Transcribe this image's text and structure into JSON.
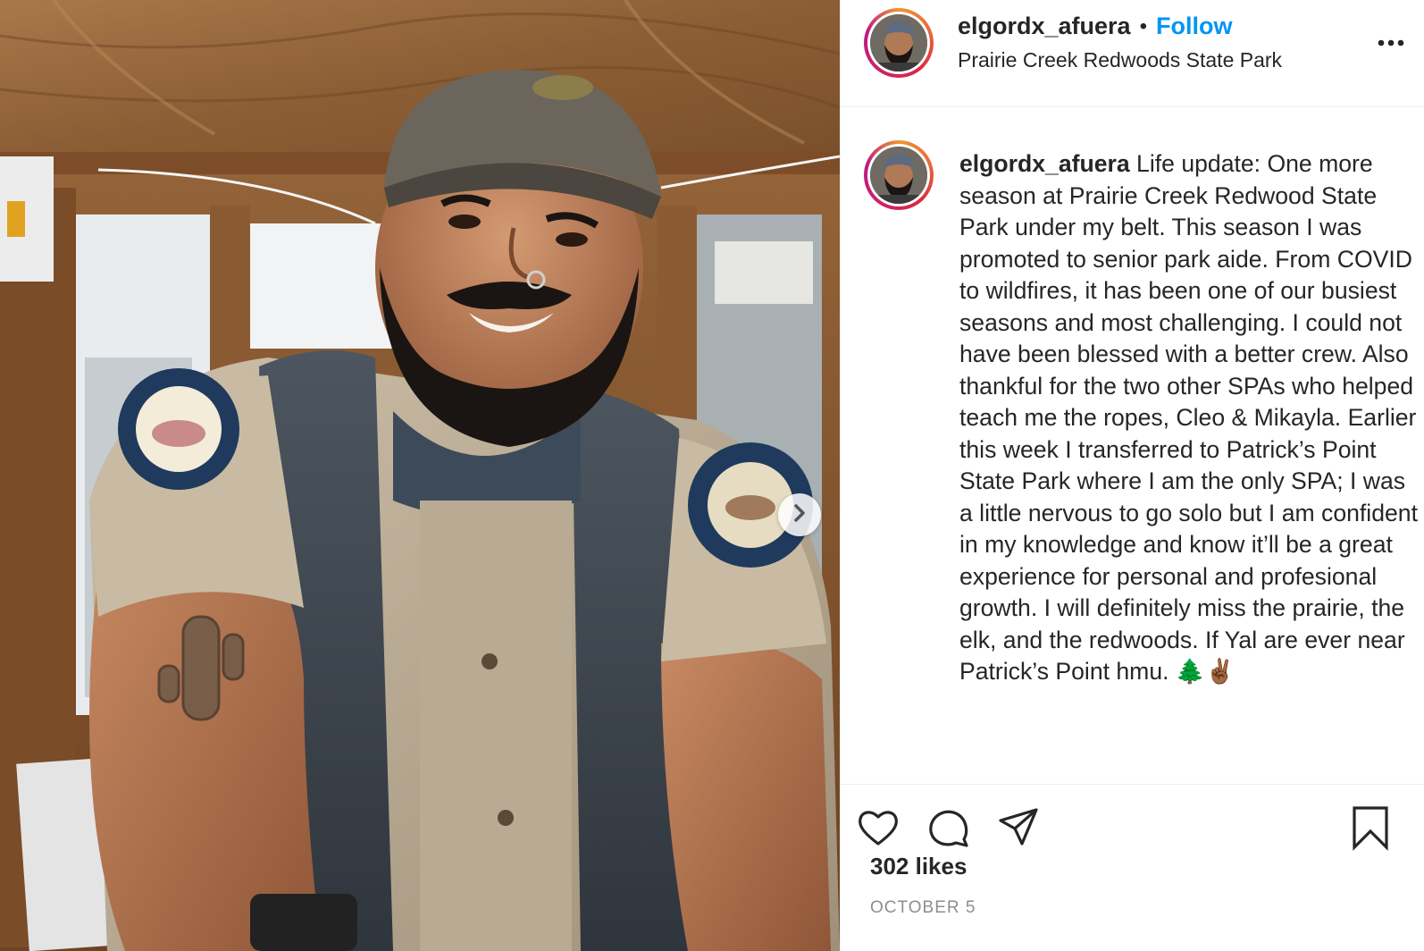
{
  "post": {
    "photo_alt": "Selfie of a smiling bearded man in a California State Parks ranger uniform and cap inside a wooden kiosk",
    "next_button": "next-arrow"
  },
  "header": {
    "username": "elgordx_afuera",
    "separator": "•",
    "follow_label": "Follow",
    "location": "Prairie Creek Redwoods State Park",
    "more_icon": "more-options-icon"
  },
  "caption": {
    "username": "elgordx_afuera",
    "text": " Life update: One more season at Prairie Creek Redwood State Park under my belt. This season I was promoted to senior park aide. From COVID to wildfires, it has been one of our busiest seasons and most challenging. I could not have been blessed with a better crew. Also thankful for the two other SPAs who helped teach me the ropes, Cleo & Mikayla. Earlier this week I transferred to Patrick’s Point State Park where I am the only SPA; I was a little nervous to go solo but I am confident in my knowledge and know it’ll be a great experience for personal and profesional growth. I will definitely miss the prairie, the elk, and the redwoods. If Yal are ever near Patrick’s Point hmu. 🌲✌🏾"
  },
  "actions": {
    "icons": [
      "heart-icon",
      "comment-icon",
      "share-icon",
      "bookmark-icon"
    ],
    "likes": "302 likes",
    "date": "OCTOBER 5"
  },
  "colors": {
    "follow": "#0095f6",
    "text": "#262626",
    "muted": "#8e8e8e",
    "border": "#efefef"
  }
}
